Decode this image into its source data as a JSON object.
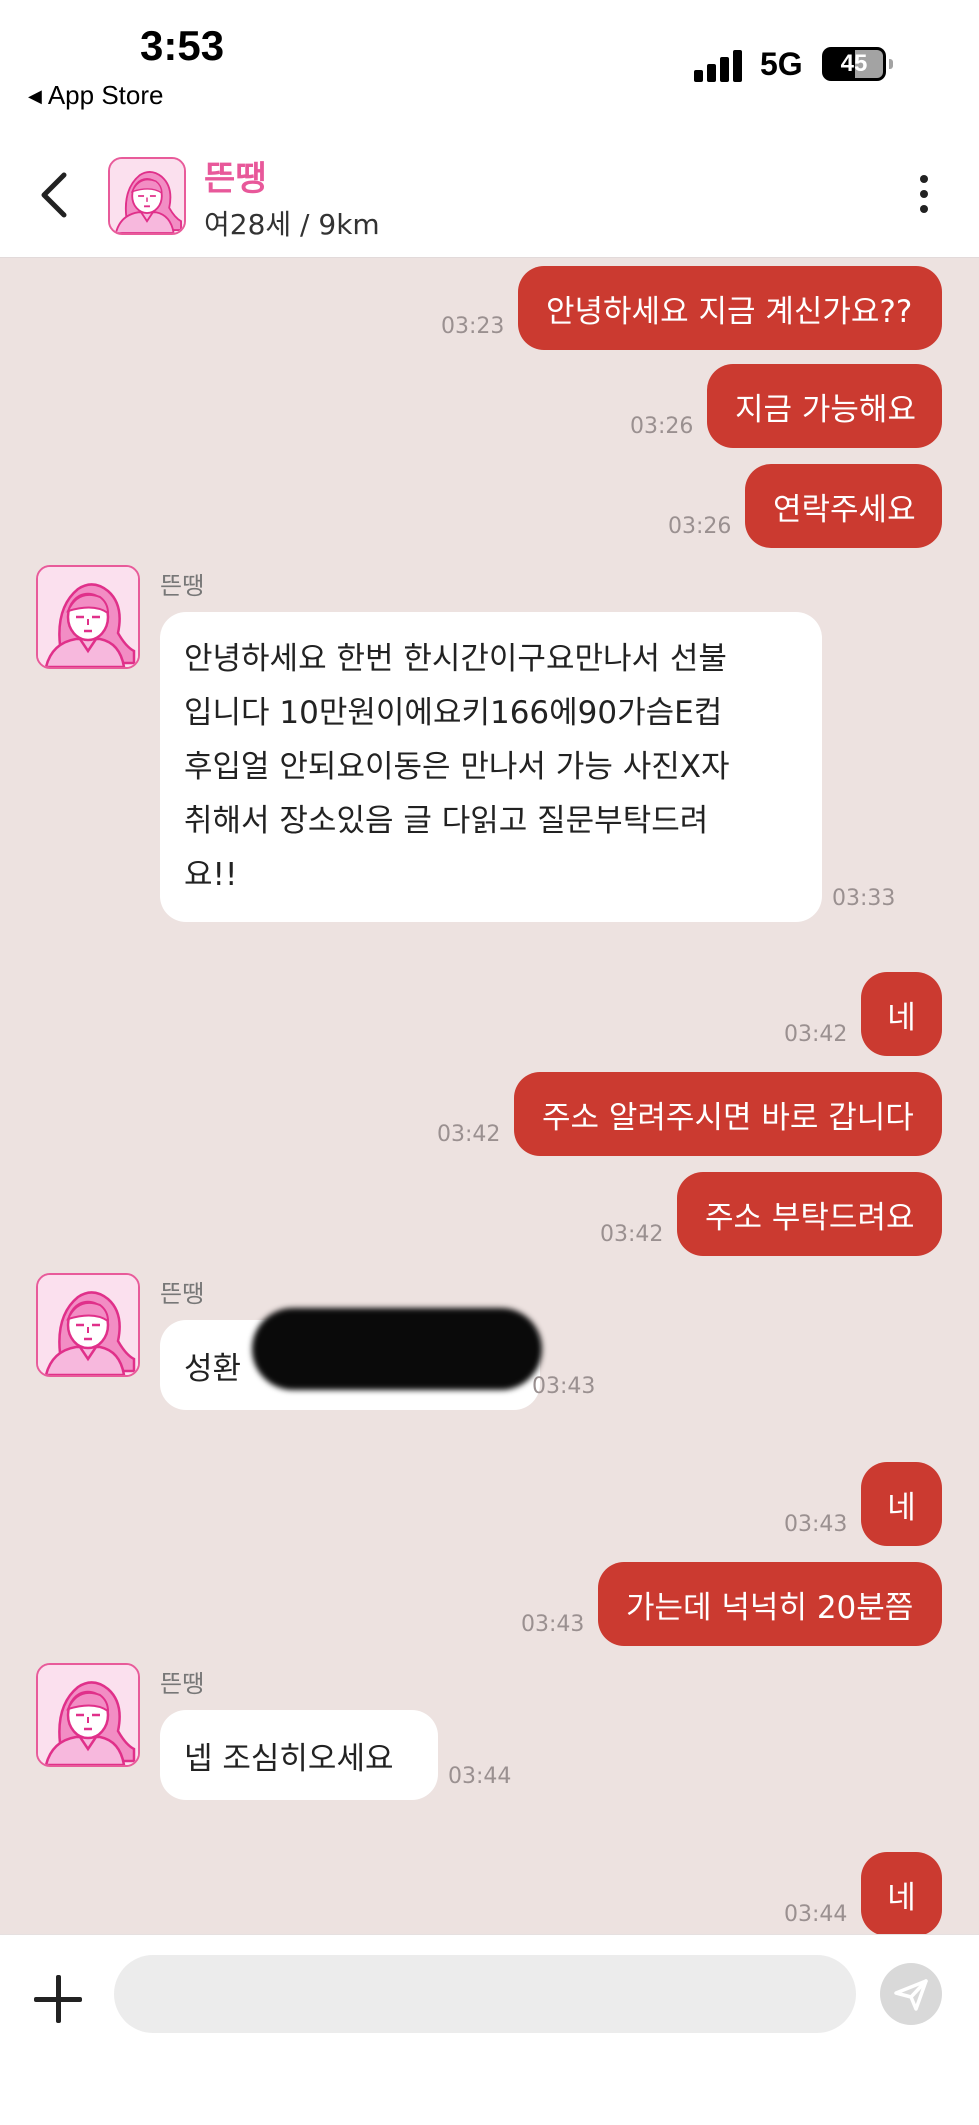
{
  "status_bar": {
    "time": "3:53",
    "back_app": "App Store",
    "network": "5G",
    "battery": "45"
  },
  "header": {
    "name": "뜬땡",
    "info": "여28세 / 9km",
    "accent_color": "#e8589a"
  },
  "colors": {
    "chat_background": "#ede2e0",
    "outgoing_bubble": "#cb3a30",
    "incoming_bubble": "#ffffff"
  },
  "messages": [
    {
      "dir": "out",
      "text": "안녕하세요 지금 계신가요??",
      "time": "03:23"
    },
    {
      "dir": "out",
      "text": "지금 가능해요",
      "time": "03:26"
    },
    {
      "dir": "out",
      "text": "연락주세요",
      "time": "03:26"
    },
    {
      "dir": "in",
      "sender": "뜬땡",
      "text": "안녕하세요 한번 한시간이구요만나서 선불\n입니다 10만원이에요키166에90가슴E컵\n후입얼 안되요이동은 만나서 가능 사진X자\n취해서 장소있음 글 다읽고 질문부탁드려\n요!!",
      "time": "03:33"
    },
    {
      "dir": "out",
      "text": "네",
      "time": "03:42"
    },
    {
      "dir": "out",
      "text": "주소 알려주시면 바로 갑니다",
      "time": "03:42"
    },
    {
      "dir": "out",
      "text": "주소 부탁드려요",
      "time": "03:42"
    },
    {
      "dir": "in",
      "sender": "뜬땡",
      "text": "성환",
      "time": "03:43"
    },
    {
      "dir": "out",
      "text": "네",
      "time": "03:43"
    },
    {
      "dir": "out",
      "text": "가는데 넉넉히 20분쯤",
      "time": "03:43"
    },
    {
      "dir": "in",
      "sender": "뜬땡",
      "text": "넵 조심히오세요",
      "time": "03:44"
    },
    {
      "dir": "out",
      "text": "네",
      "time": "03:44"
    }
  ],
  "input": {
    "placeholder": "",
    "value": ""
  },
  "icons": {
    "back": "chevron-left-icon",
    "menu": "more-vertical-icon",
    "plus": "plus-icon",
    "send": "send-icon"
  }
}
